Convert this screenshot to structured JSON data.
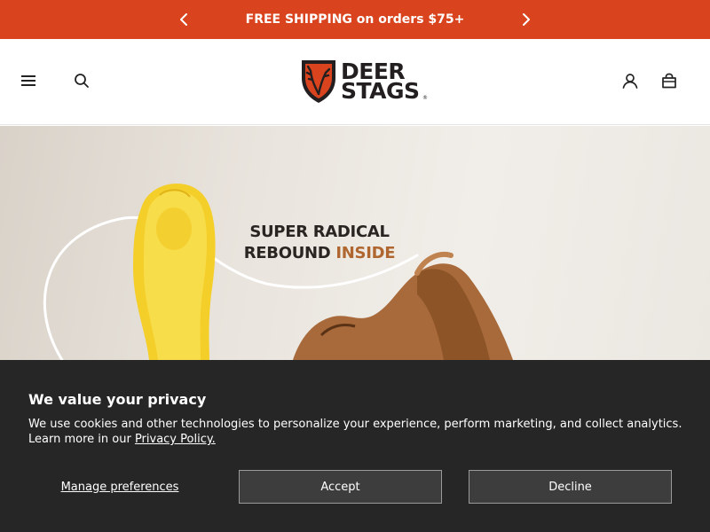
{
  "promo": {
    "text": "FREE SHIPPING on orders $75+",
    "prev_icon": "chevron-left-icon",
    "next_icon": "chevron-right-icon",
    "background": "#d9441e"
  },
  "header": {
    "menu_icon": "hamburger-menu-icon",
    "search_icon": "search-icon",
    "account_icon": "user-account-icon",
    "cart_icon": "shopping-bag-icon",
    "logo": {
      "line1": "DEER",
      "line2": "STAGS",
      "registered": "®"
    }
  },
  "hero": {
    "line1": "SUPER RADICAL",
    "line2_plain": "REBOUND ",
    "line2_accent": "INSIDE",
    "accent_color": "#b0672f"
  },
  "privacy": {
    "title": "We value your privacy",
    "body": "We use cookies and other technologies to personalize your experience, perform marketing, and collect analytics. Learn more in our ",
    "link_text": "Privacy Policy.",
    "manage_label": "Manage preferences",
    "accept_label": "Accept",
    "decline_label": "Decline",
    "background": "#262626"
  }
}
